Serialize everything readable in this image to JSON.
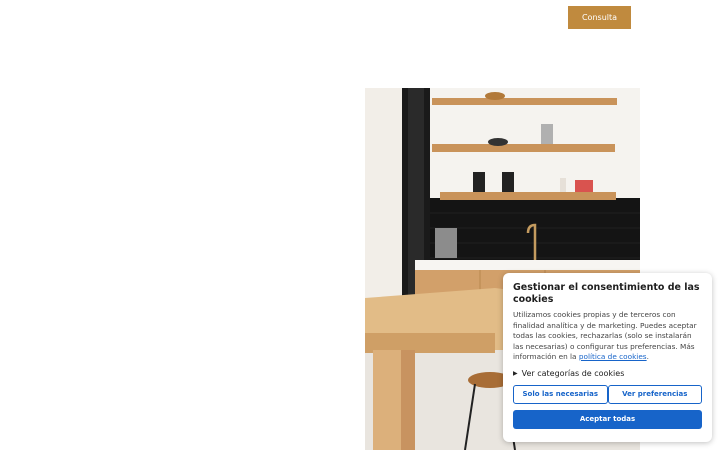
{
  "header": {
    "consulta_label": "Consulta"
  },
  "cookie_banner": {
    "title": "Gestionar el consentimiento de las cookies",
    "body_text": "Utilizamos cookies propias y de terceros con finalidad analítica y de marketing. Puedes aceptar todas las cookies, rechazarlas (solo se instalarán las necesarias) o configurar tus preferencias. Más información en la ",
    "policy_link": "política de cookies",
    "body_end": ".",
    "categories_label": "Ver categorías de cookies",
    "necessary_label": "Solo las necesarias",
    "preferences_label": "Ver preferencias",
    "accept_label": "Aceptar todas"
  },
  "colors": {
    "accent": "#c08a3e",
    "primary_blue": "#1764c9"
  }
}
